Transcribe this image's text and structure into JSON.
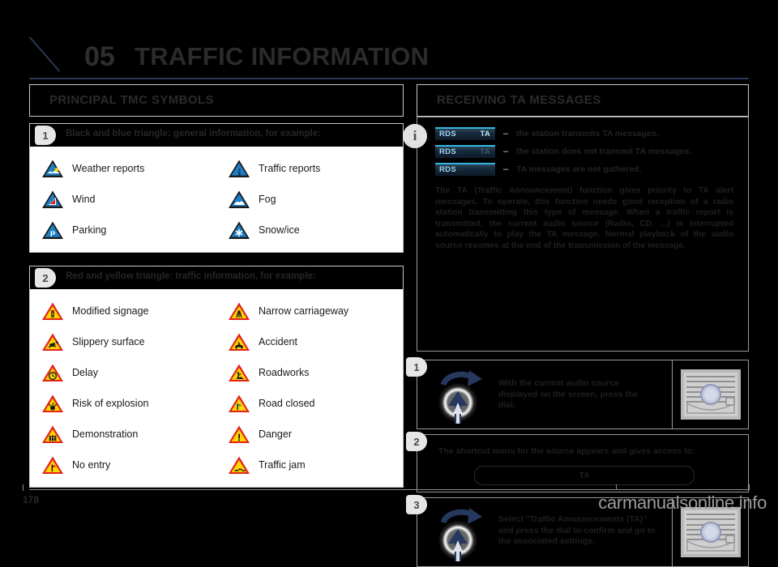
{
  "chapter": {
    "number": "05",
    "title": "TRAFFIC INFORMATION"
  },
  "sections": {
    "left_title": "PRINCIPAL TMC SYMBOLS",
    "right_title": "RECEIVING TA MESSAGES"
  },
  "left": {
    "group1": {
      "badge": "1",
      "heading": "Black and blue triangle: general information, for example:",
      "symbols": [
        {
          "label": "Weather reports",
          "icon": "blue-triangle-weather-icon"
        },
        {
          "label": "Traffic reports",
          "icon": "blue-triangle-info-icon"
        },
        {
          "label": "Wind",
          "icon": "blue-triangle-wind-icon"
        },
        {
          "label": "Fog",
          "icon": "blue-triangle-fog-icon"
        },
        {
          "label": "Parking",
          "icon": "blue-triangle-parking-icon"
        },
        {
          "label": "Snow/ice",
          "icon": "blue-triangle-snow-icon"
        }
      ]
    },
    "group2": {
      "badge": "2",
      "heading": "Red and yellow triangle: traffic information, for example:",
      "symbols": [
        {
          "label": "Modified signage",
          "icon": "warning-triangle-traffic-light-icon"
        },
        {
          "label": "Narrow carriageway",
          "icon": "warning-triangle-narrow-road-icon"
        },
        {
          "label": "Slippery surface",
          "icon": "warning-triangle-skid-icon"
        },
        {
          "label": "Accident",
          "icon": "warning-triangle-accident-icon"
        },
        {
          "label": "Delay",
          "icon": "warning-triangle-clock-icon"
        },
        {
          "label": "Roadworks",
          "icon": "warning-triangle-roadworks-icon"
        },
        {
          "label": "Risk of explosion",
          "icon": "warning-triangle-explosion-icon"
        },
        {
          "label": "Road closed",
          "icon": "warning-triangle-road-closed-icon"
        },
        {
          "label": "Demonstration",
          "icon": "warning-triangle-demonstration-icon"
        },
        {
          "label": "Danger",
          "icon": "warning-triangle-danger-icon"
        },
        {
          "label": "No entry",
          "icon": "warning-triangle-no-entry-icon"
        },
        {
          "label": "Traffic jam",
          "icon": "warning-triangle-traffic-jam-icon"
        }
      ]
    }
  },
  "right": {
    "info_icon": "i",
    "rds_rows": [
      {
        "left": "RDS",
        "right": "TA",
        "right_state": "on",
        "dash": "–",
        "text": "the station transmits TA messages."
      },
      {
        "left": "RDS",
        "right": "TA",
        "right_state": "dim",
        "dash": "–",
        "text": "the station does not transmit TA messages."
      },
      {
        "left": "RDS",
        "right": "",
        "right_state": "off",
        "dash": "–",
        "text": "TA messages are not gathered."
      }
    ],
    "ta_paragraph": "The TA (Traffic Announcement) function gives priority to TA alert messages. To operate, this function needs good reception of a radio station transmitting this type of message. When a traffic report is transmitted, the current audio source (Radio, CD, ...) is interrupted automatically to play the TA message. Normal playback of the audio source resumes at the end of the transmission of the message.",
    "steps": [
      {
        "badge": "1",
        "text": "With the current audio source displayed on the screen, press the dial.",
        "dial_icon": "rotary-dial-press-icon",
        "unit_icon": "car-audio-unit-icon"
      },
      {
        "badge": "2",
        "text": "The shortcut menu for the source appears and gives access to:",
        "pill_label": "TA"
      },
      {
        "badge": "3",
        "text": "Select \"Traffic Announcements (TA)\" and press the dial to confirm and go to the associated settings.",
        "dial_icon": "rotary-dial-press-icon",
        "unit_icon": "car-audio-unit-icon"
      }
    ]
  },
  "footer": {
    "page_number": "178",
    "watermark": "carmanualsonline.info"
  },
  "colors": {
    "background": "#000000",
    "accent_navy": "#2b3656",
    "panel_border": "#c9c9c9",
    "blue_sign": "#1d7fc3",
    "warn_red": "#e2231a",
    "warn_yellow": "#ffd400",
    "chip_cyan": "#35b6e0"
  }
}
